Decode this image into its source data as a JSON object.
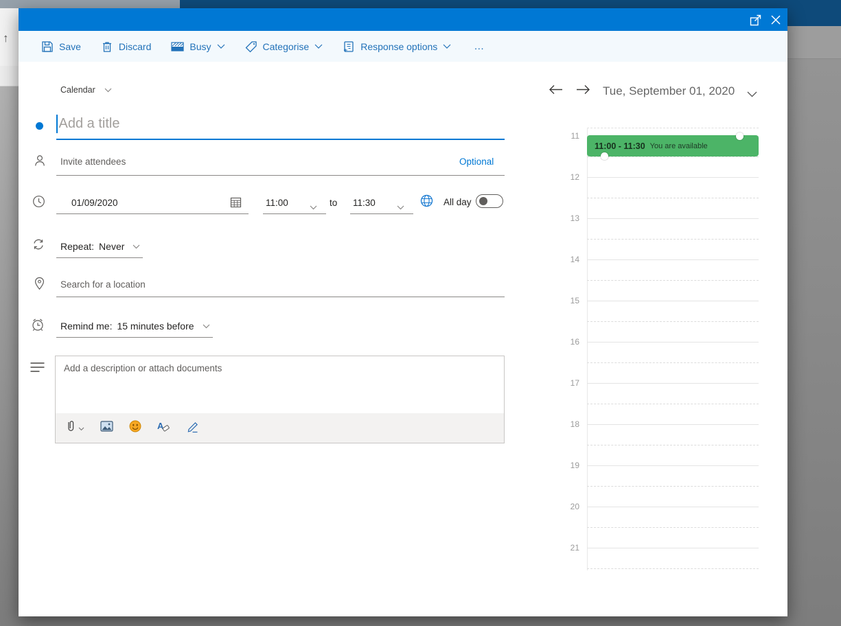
{
  "colors": {
    "accent": "#0078d4",
    "toolbar_text": "#2272b9",
    "event_green": "#4cb467"
  },
  "background": {
    "up_arrow_glyph": "↑"
  },
  "toolbar": {
    "items": [
      {
        "label": "Save"
      },
      {
        "label": "Discard"
      },
      {
        "label": "Busy"
      },
      {
        "label": "Categorise"
      },
      {
        "label": "Response options"
      }
    ],
    "more_glyph": "…"
  },
  "form": {
    "calendar_selector_label": "Calendar",
    "title_placeholder": "Add a title",
    "attendees_placeholder": "Invite attendees",
    "optional_label": "Optional",
    "date_value": "01/09/2020",
    "start_time": "11:00",
    "to_label": "to",
    "end_time": "11:30",
    "all_day_label": "All day",
    "repeat_label": "Repeat:",
    "repeat_value": "Never",
    "location_placeholder": "Search for a location",
    "remind_label": "Remind me:",
    "remind_value": "15 minutes before",
    "description_placeholder": "Add a description or attach documents"
  },
  "right_panel": {
    "date_header": "Tue, September 01, 2020",
    "hours": [
      "11",
      "12",
      "13",
      "14",
      "15",
      "16",
      "17",
      "18",
      "19",
      "20",
      "21"
    ],
    "event": {
      "time_range": "11:00 - 11:30",
      "status": "You are available"
    }
  }
}
